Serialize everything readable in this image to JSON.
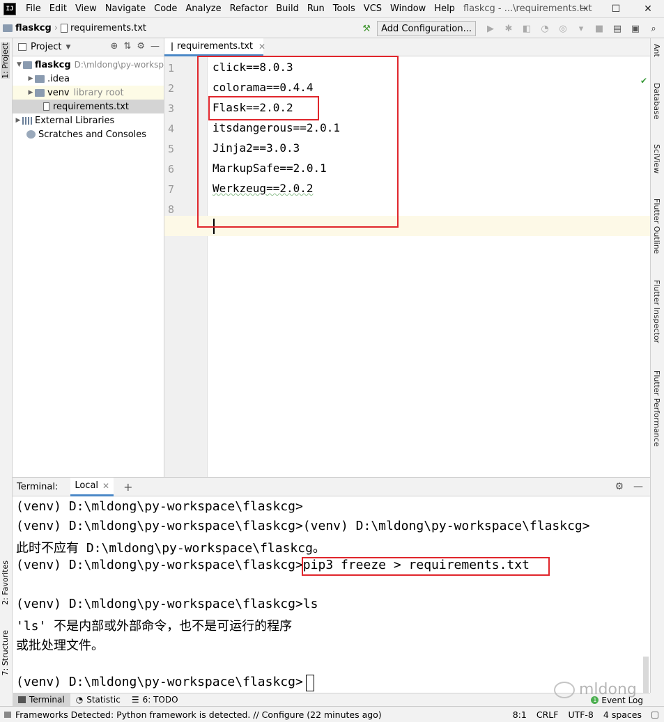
{
  "window": {
    "app_logo": "IJ",
    "title": "flaskcg - ...\\requirements.txt",
    "controls": [
      "─",
      "☐",
      "✕"
    ]
  },
  "menu": [
    "File",
    "Edit",
    "View",
    "Navigate",
    "Code",
    "Analyze",
    "Refactor",
    "Build",
    "Run",
    "Tools",
    "VCS",
    "Window",
    "Help"
  ],
  "navbar": {
    "project": "flaskcg",
    "file": "requirements.txt",
    "add_configuration": "Add Configuration..."
  },
  "left_strip": {
    "project_tab": "1: Project",
    "favorites_tab": "2: Favorites",
    "structure_tab": "7: Structure"
  },
  "right_strip": [
    "Ant",
    "Database",
    "SciView",
    "Flutter Outline",
    "Flutter Inspector",
    "Flutter Performance"
  ],
  "project_panel": {
    "header": "Project",
    "tree": [
      {
        "label": "flaskcg",
        "hint": "D:\\mldong\\py-worksp"
      },
      {
        "label": ".idea",
        "hint": ""
      },
      {
        "label": "venv",
        "hint": "library root"
      },
      {
        "label": "requirements.txt",
        "hint": ""
      },
      {
        "label": "External Libraries",
        "hint": ""
      },
      {
        "label": "Scratches and Consoles",
        "hint": ""
      }
    ]
  },
  "editor": {
    "tab": "requirements.txt",
    "line_numbers": [
      "1",
      "2",
      "3",
      "4",
      "5",
      "6",
      "7",
      "8"
    ],
    "lines": [
      "click==8.0.3",
      "colorama==0.4.4",
      "Flask==2.0.2",
      "itsdangerous==2.0.1",
      "Jinja2==3.0.3",
      "MarkupSafe==2.0.1",
      "Werkzeug==2.0.2",
      ""
    ]
  },
  "terminal": {
    "label": "Terminal:",
    "tab": "Local",
    "lines": [
      "(venv) D:\\mldong\\py-workspace\\flaskcg>",
      "(venv) D:\\mldong\\py-workspace\\flaskcg>(venv) D:\\mldong\\py-workspace\\flaskcg>",
      "此时不应有 D:\\mldong\\py-workspace\\flaskcg。",
      "(venv) D:\\mldong\\py-workspace\\flaskcg>pip3 freeze > requirements.txt",
      "",
      "(venv) D:\\mldong\\py-workspace\\flaskcg>ls",
      "'ls' 不是内部或外部命令，也不是可运行的程序",
      "或批处理文件。",
      "",
      "(venv) D:\\mldong\\py-workspace\\flaskcg>"
    ]
  },
  "bottom_tabs": {
    "terminal": "Terminal",
    "statistic": "Statistic",
    "todo": "6: TODO",
    "event_log": "Event Log",
    "event_count": "1"
  },
  "statusbar": {
    "message": "Frameworks Detected: Python framework is detected. // Configure (22 minutes ago)",
    "position": "8:1",
    "line_sep": "CRLF",
    "encoding": "UTF-8",
    "indent": "4 spaces"
  },
  "watermark": "mldong"
}
